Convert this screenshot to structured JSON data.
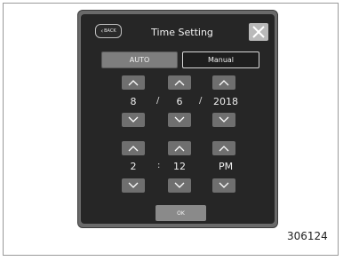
{
  "header": {
    "back_label": "BACK",
    "title": "Time Setting"
  },
  "modes": {
    "auto_label": "AUTO",
    "manual_label": "Manual",
    "selected": "Manual"
  },
  "date": {
    "month": "8",
    "day": "6",
    "year": "2018",
    "separator": "/"
  },
  "time": {
    "hour": "2",
    "minute": "12",
    "period": "PM",
    "separator": ":"
  },
  "footer": {
    "ok_label": "OK"
  },
  "figure_number": "306124",
  "colors": {
    "panel": "#262626",
    "bezel": "#6a6a6a",
    "button": "#6f6f6f",
    "auto_button": "#7e7e7e"
  }
}
